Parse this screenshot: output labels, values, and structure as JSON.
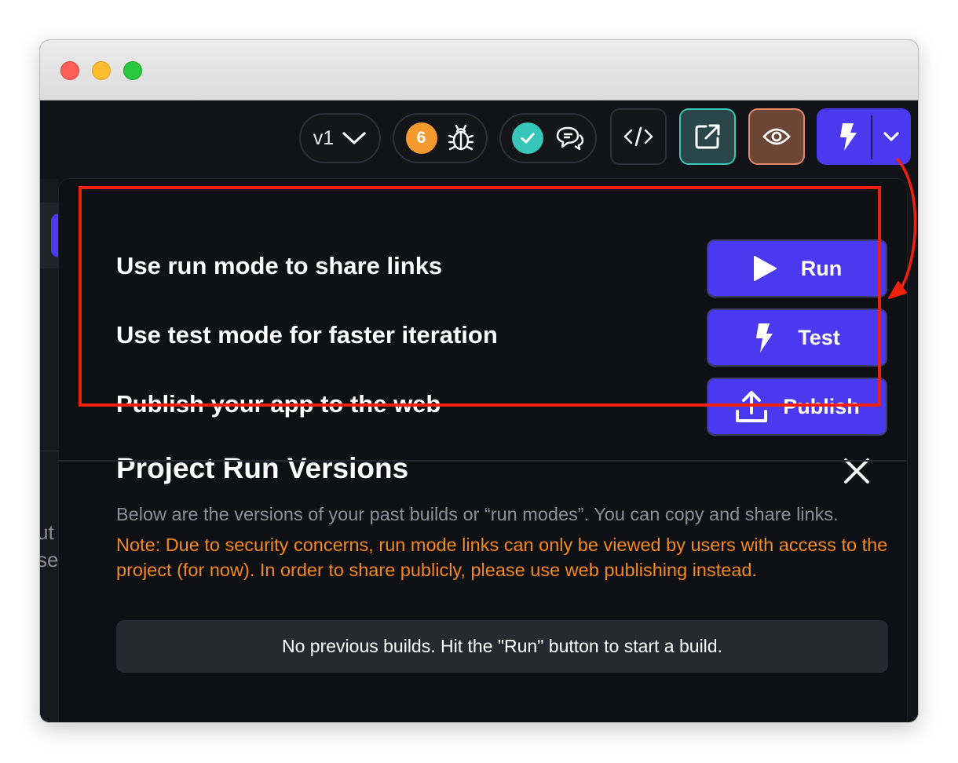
{
  "toolbar": {
    "version_label": "v1",
    "bug_count": "6",
    "icons": [
      "chevron-down-icon",
      "bug-icon",
      "check-icon",
      "chat-bubbles-icon",
      "code-icon",
      "open-external-icon",
      "eye-icon",
      "lightning-icon"
    ]
  },
  "left_panel": {
    "partial_text_1": "ut",
    "partial_text_2": "se"
  },
  "actions": [
    {
      "label": "Use run mode to share links",
      "button": "Run",
      "icon": "play-icon"
    },
    {
      "label": "Use test mode for faster iteration",
      "button": "Test",
      "icon": "lightning-icon"
    },
    {
      "label": "Publish your app to the web",
      "button": "Publish",
      "icon": "upload-icon"
    }
  ],
  "versions": {
    "title": "Project Run Versions",
    "description": "Below are the versions of your past builds or “run modes”. You can copy and share links.",
    "note": "Note: Due to security concerns, run mode links can only be viewed by users with access to the project (for now). In order to share publicly, please use web publishing instead.",
    "empty_message": "No previous builds. Hit the \"Run\" button to start a build."
  },
  "colors": {
    "accent": "#4b39ef",
    "warning": "#f5891f",
    "highlight": "#f0200f",
    "teal": "#37c6b9",
    "orange_badge": "#f59a2f",
    "brown_button": "#6b4637"
  }
}
